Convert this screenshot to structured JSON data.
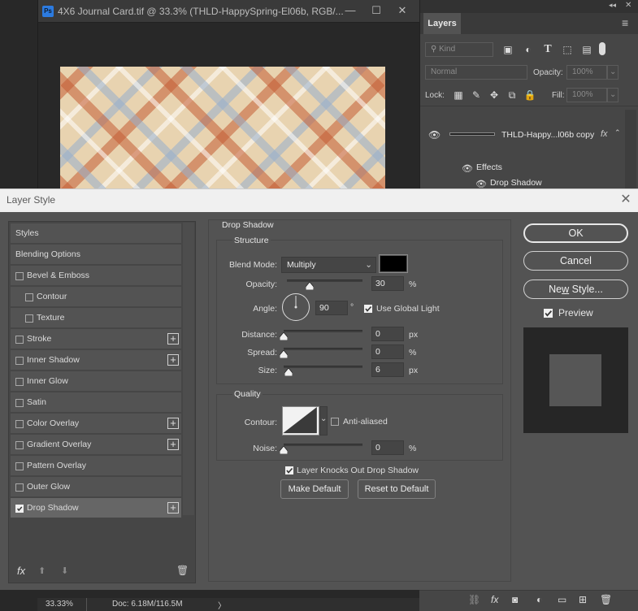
{
  "document": {
    "ps_badge": "Ps",
    "title": "4X6 Journal Card.tif @ 33.3% (THLD-HappySpring-El06b, RGB/...",
    "minimize_glyph": "—",
    "restore_glyph": "☐",
    "close_glyph": "✕"
  },
  "layers_panel": {
    "tab": "Layers",
    "collapse_glyph": "◂◂",
    "close_glyph": "✕",
    "menu_glyph": "≡",
    "kind_placeholder": "Kind",
    "blend_mode": "Normal",
    "opacity_label": "Opacity:",
    "opacity_value": "100%",
    "lock_label": "Lock:",
    "fill_label": "Fill:",
    "fill_value": "100%",
    "layer_name": "THLD-Happy...l06b copy",
    "fx_glyph": "fx",
    "effects_label": "Effects",
    "drop_shadow_effect": "Drop Shadow"
  },
  "dialog": {
    "title": "Layer Style",
    "close_glyph": "✕"
  },
  "styles_list": [
    {
      "label": "Styles",
      "indent": 0,
      "checkbox": false,
      "checked": false,
      "plus": false,
      "selected": false
    },
    {
      "label": "Blending Options",
      "indent": 0,
      "checkbox": false,
      "checked": false,
      "plus": false,
      "selected": false
    },
    {
      "label": "Bevel & Emboss",
      "indent": 0,
      "checkbox": true,
      "checked": false,
      "plus": false,
      "selected": false
    },
    {
      "label": "Contour",
      "indent": 1,
      "checkbox": true,
      "checked": false,
      "plus": false,
      "selected": false
    },
    {
      "label": "Texture",
      "indent": 1,
      "checkbox": true,
      "checked": false,
      "plus": false,
      "selected": false
    },
    {
      "label": "Stroke",
      "indent": 0,
      "checkbox": true,
      "checked": false,
      "plus": true,
      "selected": false
    },
    {
      "label": "Inner Shadow",
      "indent": 0,
      "checkbox": true,
      "checked": false,
      "plus": true,
      "selected": false
    },
    {
      "label": "Inner Glow",
      "indent": 0,
      "checkbox": true,
      "checked": false,
      "plus": false,
      "selected": false
    },
    {
      "label": "Satin",
      "indent": 0,
      "checkbox": true,
      "checked": false,
      "plus": false,
      "selected": false
    },
    {
      "label": "Color Overlay",
      "indent": 0,
      "checkbox": true,
      "checked": false,
      "plus": true,
      "selected": false
    },
    {
      "label": "Gradient Overlay",
      "indent": 0,
      "checkbox": true,
      "checked": false,
      "plus": true,
      "selected": false
    },
    {
      "label": "Pattern Overlay",
      "indent": 0,
      "checkbox": true,
      "checked": false,
      "plus": false,
      "selected": false
    },
    {
      "label": "Outer Glow",
      "indent": 0,
      "checkbox": true,
      "checked": false,
      "plus": false,
      "selected": false
    },
    {
      "label": "Drop Shadow",
      "indent": 0,
      "checkbox": true,
      "checked": true,
      "plus": true,
      "selected": true
    }
  ],
  "styles_footer": {
    "fx": "fx",
    "up": "⬆",
    "down": "⬇",
    "trash": "🗑"
  },
  "drop_shadow": {
    "section_title": "Drop Shadow",
    "structure_title": "Structure",
    "blend_mode_label": "Blend Mode:",
    "blend_mode_value": "Multiply",
    "shadow_color": "#000000",
    "opacity_label": "Opacity:",
    "opacity_value": "30",
    "opacity_unit": "%",
    "angle_label": "Angle:",
    "angle_value": "90",
    "angle_unit": "°",
    "use_global_light_label": "Use Global Light",
    "use_global_light": true,
    "distance_label": "Distance:",
    "distance_value": "0",
    "distance_unit": "px",
    "spread_label": "Spread:",
    "spread_value": "0",
    "spread_unit": "%",
    "size_label": "Size:",
    "size_value": "6",
    "size_unit": "px",
    "quality_title": "Quality",
    "contour_label": "Contour:",
    "anti_aliased_label": "Anti-aliased",
    "anti_aliased": false,
    "noise_label": "Noise:",
    "noise_value": "0",
    "noise_unit": "%",
    "knocks_out_label": "Layer Knocks Out Drop Shadow",
    "knocks_out": true,
    "make_default": "Make Default",
    "reset_default": "Reset to Default"
  },
  "right_buttons": {
    "ok": "OK",
    "cancel": "Cancel",
    "new_style": "New Style...",
    "preview_label": "Preview",
    "preview_checked": true
  },
  "status": {
    "zoom": "33.33%",
    "doc_info": "Doc: 6.18M/116.5M",
    "arrow": "〉"
  },
  "colors": {
    "panel_bg": "#535353",
    "dialog_header": "#f0f0f0",
    "selected_row": "#666666",
    "canvas_base": "#e8d3b0"
  }
}
